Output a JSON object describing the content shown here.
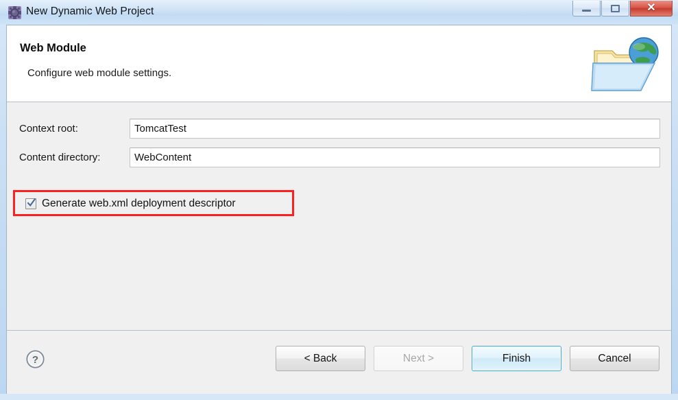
{
  "window": {
    "title": "New Dynamic Web Project",
    "icon": "eclipse-wizard-icon",
    "controls": {
      "minimize": "minimize-icon",
      "maximize": "maximize-icon",
      "close": "✕"
    }
  },
  "header": {
    "title": "Web Module",
    "description": "Configure web module settings.",
    "banner_icon": "web-folder-globe-icon"
  },
  "form": {
    "fields": [
      {
        "label": "Context root:",
        "value": "TomcatTest",
        "placeholder": ""
      },
      {
        "label": "Content directory:",
        "value": "WebContent",
        "placeholder": ""
      }
    ],
    "checkbox": {
      "label": "Generate web.xml deployment descriptor",
      "checked": true,
      "highlight_color": "#fc2121"
    }
  },
  "footer": {
    "help_label": "?",
    "buttons": [
      {
        "label": "< Back",
        "state": "enabled"
      },
      {
        "label": "Next >",
        "state": "disabled"
      },
      {
        "label": "Finish",
        "state": "default"
      },
      {
        "label": "Cancel",
        "state": "enabled"
      }
    ]
  }
}
